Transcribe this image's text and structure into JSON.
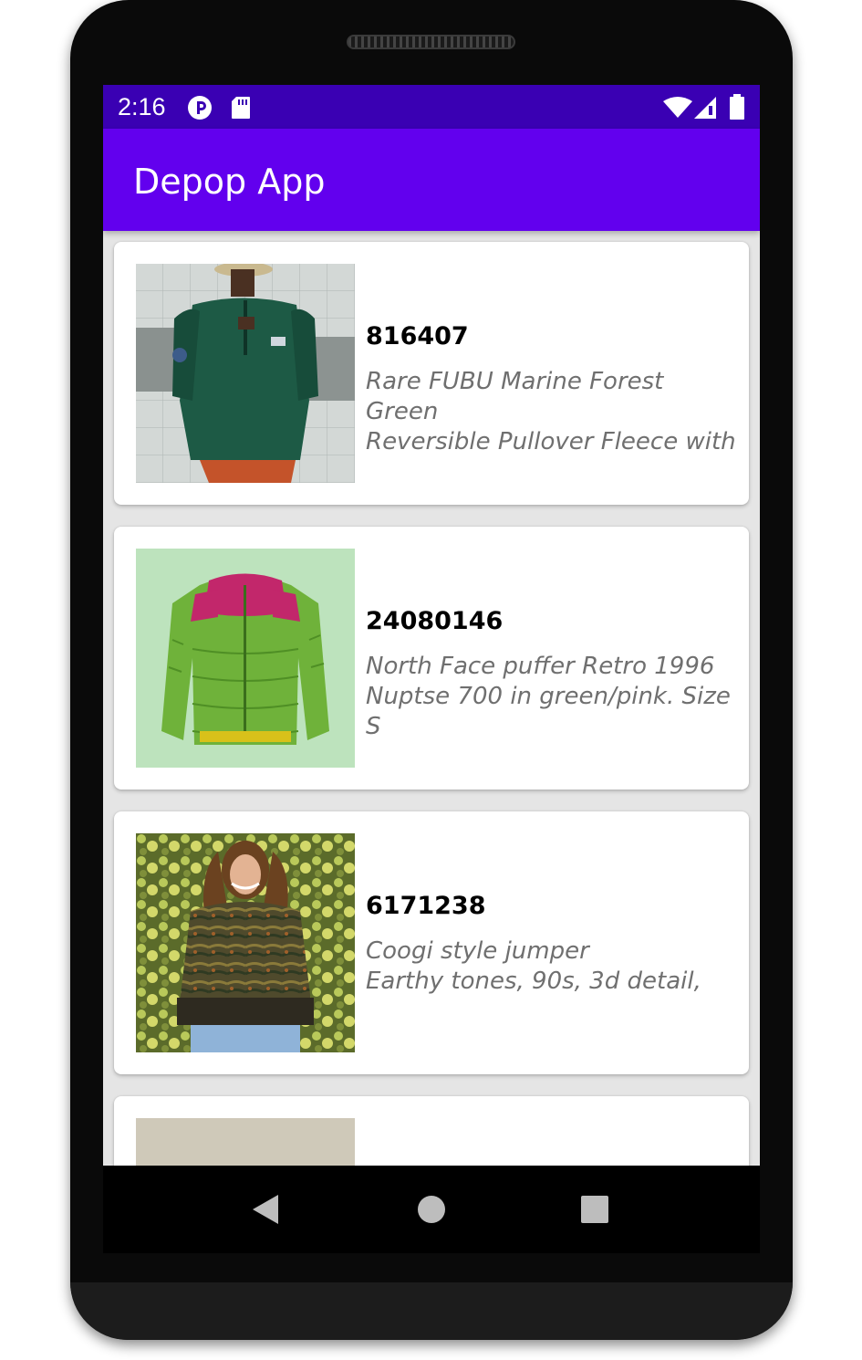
{
  "status_bar": {
    "time": "2:16",
    "icons": [
      "notification-icon",
      "sd-card-icon",
      "wifi-icon",
      "signal-icon",
      "battery-icon"
    ]
  },
  "app_bar": {
    "title": "Depop App"
  },
  "products": [
    {
      "id": "816407",
      "description": "Rare FUBU Marine Forest Green\nReversible Pullover Fleece with"
    },
    {
      "id": "24080146",
      "description": "North Face puffer Retro 1996\nNuptse 700 in green/pink. Size S"
    },
    {
      "id": "6171238",
      "description": "Coogi style jumper\nEarthy tones, 90s, 3d detail,"
    },
    {
      "id": "",
      "description": ""
    }
  ],
  "nav": [
    "back-icon",
    "home-icon",
    "recents-icon"
  ],
  "colors": {
    "status_bar": "#3a00b3",
    "app_bar": "#6200ee",
    "list_background": "#e5e5e5"
  }
}
